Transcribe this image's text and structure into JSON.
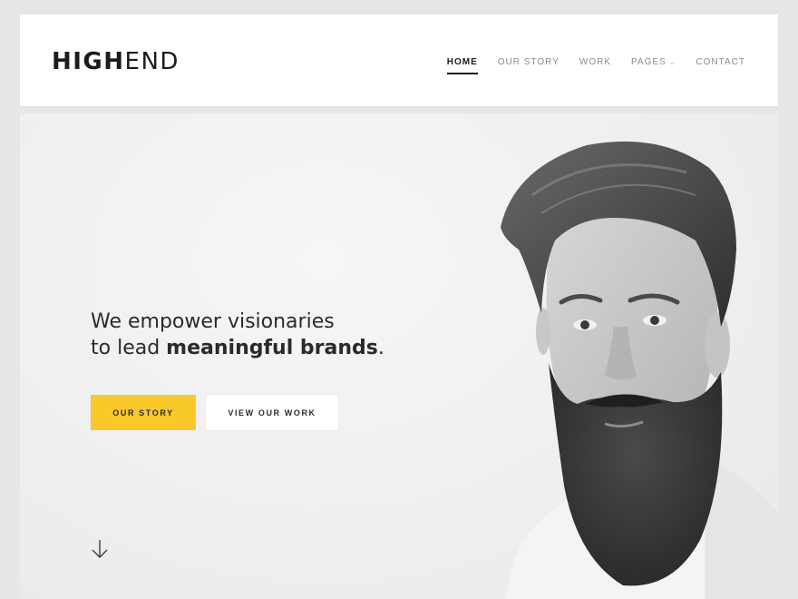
{
  "header": {
    "logo_bold": "HIGH",
    "logo_light": "END",
    "nav": [
      {
        "label": "HOME",
        "active": true
      },
      {
        "label": "OUR STORY",
        "active": false
      },
      {
        "label": "WORK",
        "active": false
      },
      {
        "label": "PAGES",
        "active": false,
        "has_dropdown": true
      },
      {
        "label": "CONTACT",
        "active": false
      }
    ]
  },
  "hero": {
    "line1": "We empower visionaries",
    "line2_prefix": "to lead ",
    "line2_bold": "meaningful brands",
    "line2_suffix": ".",
    "primary_button": "OUR STORY",
    "secondary_button": "VIEW OUR WORK"
  },
  "icons": {
    "nav_dropdown": "chevron-down-icon",
    "scroll": "arrow-down-icon"
  },
  "colors": {
    "accent": "#f9c92c",
    "text": "#222222",
    "nav_muted": "#8a8a8a",
    "page_bg": "#e7e7e7"
  }
}
